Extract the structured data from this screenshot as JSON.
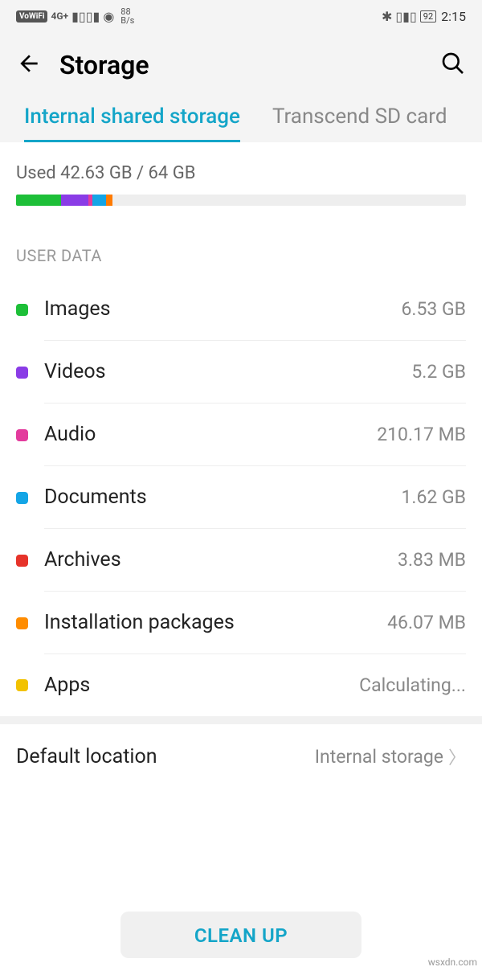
{
  "status": {
    "vowifi": "VoWiFi",
    "net": "4G+",
    "speed_num": "88",
    "speed_unit": "B/s",
    "battery": "92",
    "time": "2:15"
  },
  "header": {
    "title": "Storage"
  },
  "tabs": {
    "active": "Internal shared storage",
    "other": "Transcend SD card"
  },
  "usage": {
    "text": "Used 42.63 GB / 64 GB",
    "segments": [
      {
        "color": "#1dbf38",
        "pct": 10
      },
      {
        "color": "#8a3ce6",
        "pct": 6
      },
      {
        "color": "#e33b9d",
        "pct": 1
      },
      {
        "color": "#14a5e6",
        "pct": 3
      },
      {
        "color": "#ff7b00",
        "pct": 1.5
      }
    ]
  },
  "section_header": "USER DATA",
  "items": [
    {
      "label": "Images",
      "value": "6.53 GB",
      "color": "#1dbf38"
    },
    {
      "label": "Videos",
      "value": "5.2 GB",
      "color": "#8a3ce6"
    },
    {
      "label": "Audio",
      "value": "210.17 MB",
      "color": "#e33b9d"
    },
    {
      "label": "Documents",
      "value": "1.62 GB",
      "color": "#14a5e6"
    },
    {
      "label": "Archives",
      "value": "3.83 MB",
      "color": "#e6332a"
    },
    {
      "label": "Installation packages",
      "value": "46.07 MB",
      "color": "#ff8c00"
    },
    {
      "label": "Apps",
      "value": "Calculating...",
      "color": "#f2c200"
    }
  ],
  "default_location": {
    "label": "Default location",
    "value": "Internal storage"
  },
  "cleanup": "CLEAN UP",
  "watermark": "wsxdn.com"
}
